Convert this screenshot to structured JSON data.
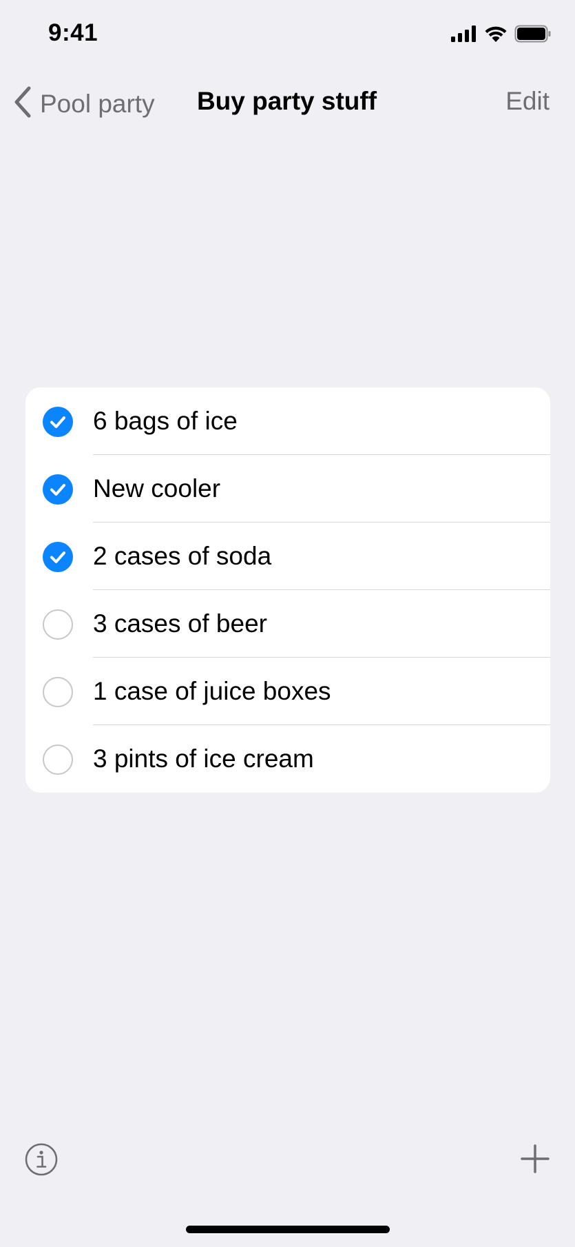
{
  "status_bar": {
    "time": "9:41"
  },
  "nav": {
    "back_label": "Pool party",
    "title": "Buy party stuff",
    "edit_label": "Edit"
  },
  "list": {
    "items": [
      {
        "label": "6 bags of ice",
        "checked": true
      },
      {
        "label": "New cooler",
        "checked": true
      },
      {
        "label": "2 cases of soda",
        "checked": true
      },
      {
        "label": "3 cases of beer",
        "checked": false
      },
      {
        "label": "1 case of juice boxes",
        "checked": false
      },
      {
        "label": "3 pints of ice cream",
        "checked": false
      }
    ]
  },
  "colors": {
    "accent": "#0A84FF",
    "background": "#EFEFF4",
    "secondary_text": "#6D6D72"
  },
  "icons": {
    "back": "chevron-left-icon",
    "info": "info-icon",
    "add": "plus-icon"
  }
}
